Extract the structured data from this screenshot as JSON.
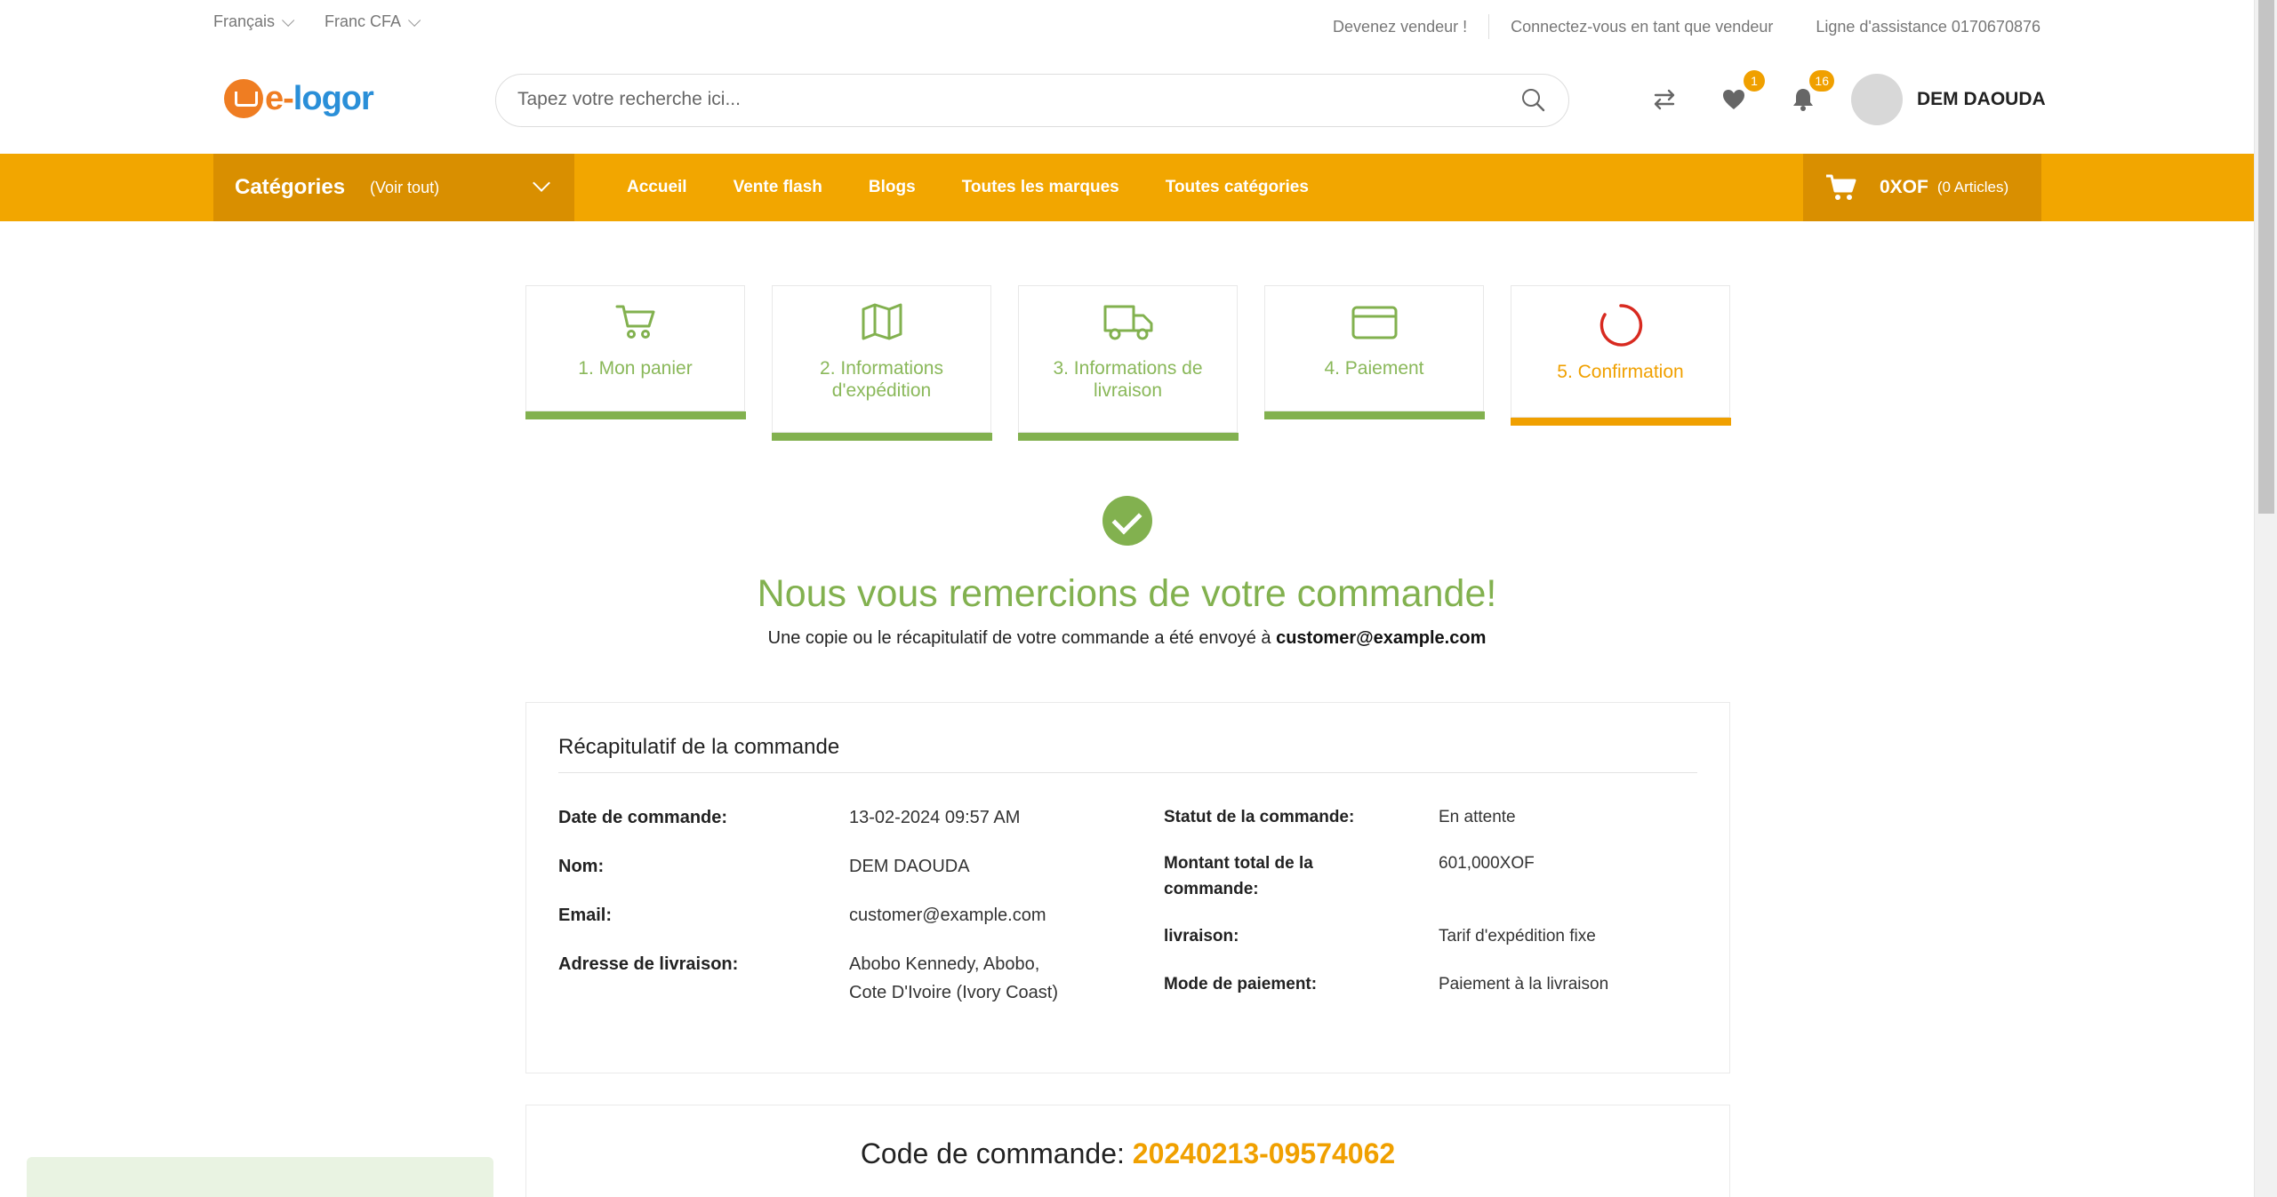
{
  "topbar": {
    "language": "Français",
    "currency": "Franc CFA",
    "become_seller": "Devenez vendeur !",
    "seller_login": "Connectez-vous en tant que vendeur",
    "helpline": "Ligne d'assistance 0170670876"
  },
  "header": {
    "logo_prefix": "e-",
    "logo_text": "logor",
    "search_placeholder": "Tapez votre recherche ici...",
    "wishlist_count": "1",
    "notification_count": "16",
    "user_name": "DEM DAOUDA"
  },
  "nav": {
    "categories_title": "Catégories",
    "categories_sub": "(Voir tout)",
    "links": [
      "Accueil",
      "Vente flash",
      "Blogs",
      "Toutes les marques",
      "Toutes catégories"
    ],
    "cart_amount": "0XOF",
    "cart_count": "(0 Articles)"
  },
  "steps": [
    {
      "label": "1. Mon panier",
      "icon": "cart-icon"
    },
    {
      "label": "2. Informations d'expédition",
      "icon": "map-icon"
    },
    {
      "label": "3. Informations de livraison",
      "icon": "truck-icon"
    },
    {
      "label": "4. Paiement",
      "icon": "card-icon"
    },
    {
      "label": "5. Confirmation",
      "icon": "spinner-icon"
    }
  ],
  "confirmation": {
    "title": "Nous vous remercions de votre commande!",
    "copy_text": "Une copie ou le récapitulatif de votre commande a été envoyé à",
    "email": "customer@example.com"
  },
  "summary": {
    "title": "Récapitulatif de la commande",
    "left": [
      {
        "key": "Date de commande:",
        "value": "13-02-2024 09:57 AM"
      },
      {
        "key": "Nom:",
        "value": "DEM DAOUDA"
      },
      {
        "key": "Email:",
        "value": "customer@example.com"
      },
      {
        "key": "Adresse de livraison:",
        "value_line1": "Abobo Kennedy, Abobo,",
        "value_line2": "Cote D'Ivoire (Ivory Coast)"
      }
    ],
    "right": [
      {
        "key": "Statut de la commande:",
        "value": "En attente"
      },
      {
        "key_line1": "Montant total de la",
        "key_line2": "commande:",
        "value": "601,000XOF"
      },
      {
        "key": "livraison:",
        "value": "Tarif d'expédition fixe"
      },
      {
        "key": "Mode de paiement:",
        "value": "Paiement à la livraison"
      }
    ]
  },
  "order_code": {
    "label": "Code de commande:",
    "value": "20240213-09574062"
  },
  "colors": {
    "accent_orange": "#f2a600",
    "success_green": "#82b14f"
  }
}
